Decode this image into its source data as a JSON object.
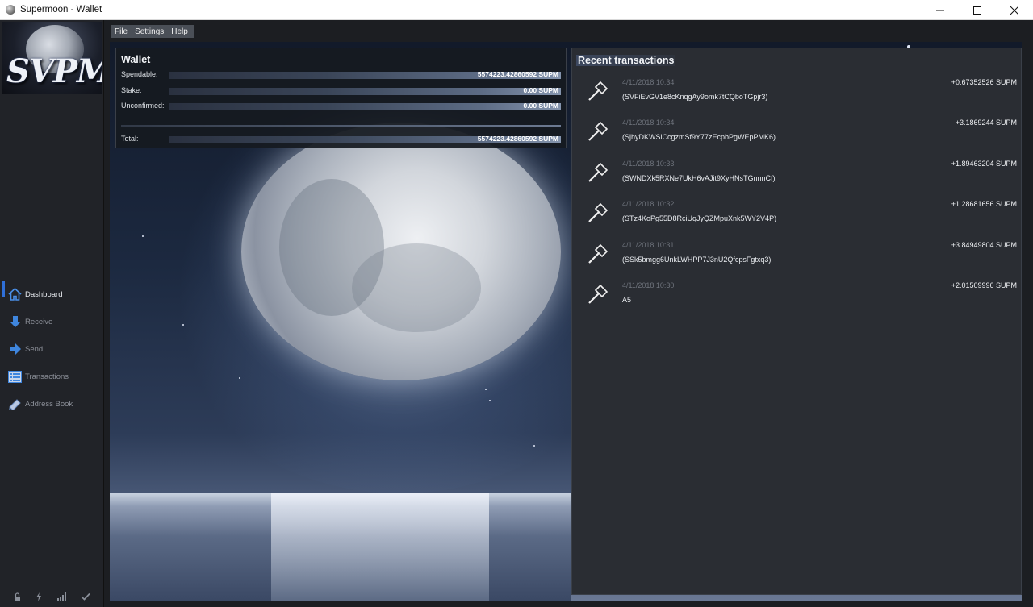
{
  "window": {
    "title": "Supermoon - Wallet",
    "controls": [
      "minimize",
      "maximize",
      "close"
    ]
  },
  "logo": {
    "text": "SVPM"
  },
  "menu": {
    "items": [
      "File",
      "Settings",
      "Help"
    ]
  },
  "sidebar": {
    "items": [
      {
        "label": "Dashboard",
        "icon": "home-icon",
        "active": true
      },
      {
        "label": "Receive",
        "icon": "download-arrow-icon",
        "active": false
      },
      {
        "label": "Send",
        "icon": "send-arrow-icon",
        "active": false
      },
      {
        "label": "Transactions",
        "icon": "list-icon",
        "active": false
      },
      {
        "label": "Address Book",
        "icon": "book-icon",
        "active": false
      }
    ],
    "status_icons": [
      "lock-icon",
      "lightning-icon",
      "signal-icon",
      "checkmark-icon"
    ]
  },
  "wallet": {
    "title": "Wallet",
    "spendable_label": "Spendable:",
    "spendable_value": "5574223.42860592 SUPM",
    "stake_label": "Stake:",
    "stake_value": "0.00 SUPM",
    "unconfirmed_label": "Unconfirmed:",
    "unconfirmed_value": "0.00 SUPM",
    "total_label": "Total:",
    "total_value": "5574223.42860592 SUPM"
  },
  "recent": {
    "title": "Recent transactions",
    "transactions": [
      {
        "date": "4/11/2018 10:34",
        "amount": "+0.67352526 SUPM",
        "address": "(SVFiEvGV1e8cKnqgAy9omk7tCQboTGpjr3)",
        "icon": "mining-hammer-icon"
      },
      {
        "date": "4/11/2018 10:34",
        "amount": "+3.1869244 SUPM",
        "address": "(SjhyDKWSiCcgzmSf9Y77zEcpbPgWEpPMK6)",
        "icon": "mining-hammer-icon"
      },
      {
        "date": "4/11/2018 10:33",
        "amount": "+1.89463204 SUPM",
        "address": "(SWNDXk5RXNe7UkH6vAJit9XyHNsTGnnnCf)",
        "icon": "mining-hammer-icon"
      },
      {
        "date": "4/11/2018 10:32",
        "amount": "+1.28681656 SUPM",
        "address": "(STz4KoPg55D8RciUqJyQZMpuXnk5WY2V4P)",
        "icon": "mining-hammer-icon"
      },
      {
        "date": "4/11/2018 10:31",
        "amount": "+3.84949804 SUPM",
        "address": "(SSk5bmgg6UnkLWHPP7J3nU2QfcpsFgtxq3)",
        "icon": "mining-hammer-icon"
      },
      {
        "date": "4/11/2018 10:30",
        "amount": "+2.01509996 SUPM",
        "address": "A5",
        "icon": "mining-hammer-icon"
      }
    ]
  }
}
